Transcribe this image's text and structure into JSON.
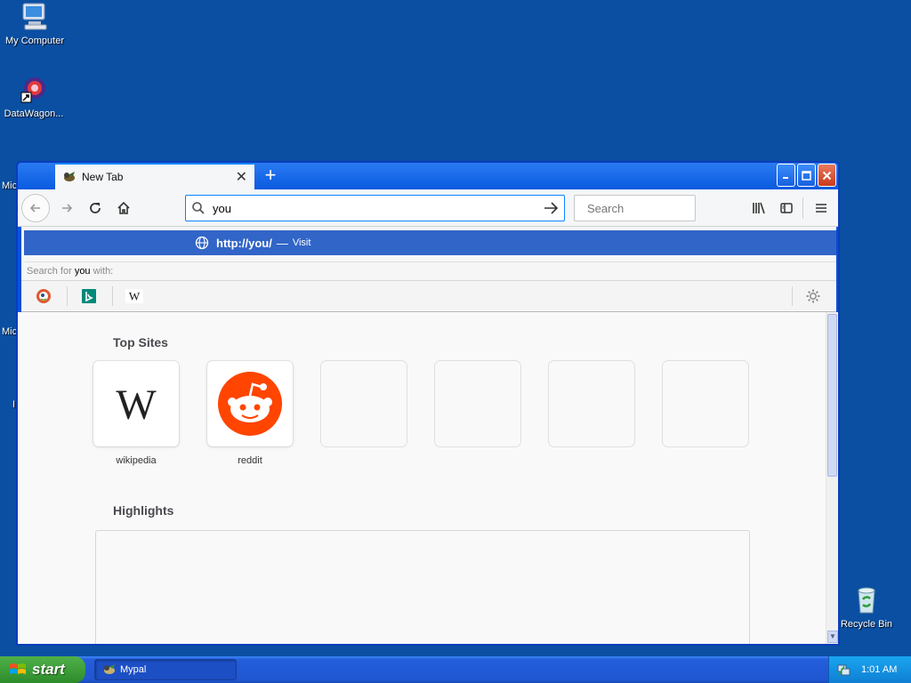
{
  "desktop": {
    "icons": [
      {
        "label": "My Computer"
      },
      {
        "label": "DataWagon..."
      },
      {
        "label": "Recycle Bin"
      }
    ],
    "partial_labels": [
      "Mic",
      "Mic",
      "I"
    ]
  },
  "browser": {
    "tab_title": "New Tab",
    "new_tab_symbol": "+",
    "url_value": "you",
    "search_placeholder": "Search",
    "autocomplete": {
      "url": "http://you/",
      "dash": "—",
      "action": "Visit"
    },
    "search_for": {
      "prefix": "Search for ",
      "term": "you",
      "suffix": " with:"
    },
    "engines": [
      "duckduckgo-icon",
      "bing-icon",
      "wikipedia-icon"
    ],
    "top_sites_title": "Top Sites",
    "top_sites": [
      {
        "label": "wikipedia"
      },
      {
        "label": "reddit"
      }
    ],
    "highlights_title": "Highlights"
  },
  "taskbar": {
    "start_label": "start",
    "task_label": "Mypal",
    "clock": "1:01 AM"
  },
  "colors": {
    "desktop": "#0a4fa2",
    "accent": "#0a84ff",
    "autocomplete_highlight": "#3265c8",
    "reddit": "#ff4500"
  }
}
